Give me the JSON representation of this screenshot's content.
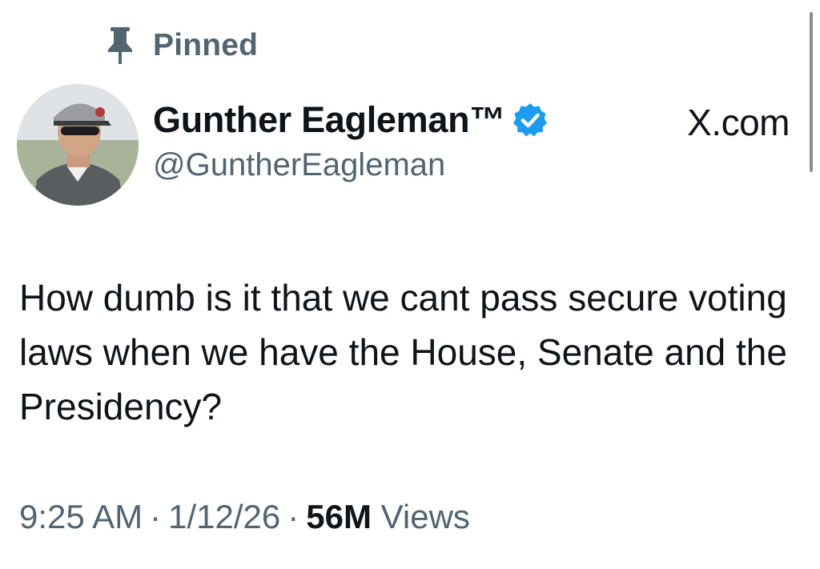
{
  "header": {
    "pinned_label": "Pinned"
  },
  "author": {
    "display_name": "Gunther Eagleman™",
    "handle": "@GuntherEagleman",
    "verified": true
  },
  "site_label": "X.com",
  "tweet": {
    "text": "How dumb is it that we cant pass secure voting laws when we have the House, Senate and the Presidency?"
  },
  "meta": {
    "time": "9:25 AM",
    "date": "1/12/26",
    "separator": "·",
    "views_count": "56M",
    "views_label": "Views"
  },
  "icons": {
    "pin": "pin-icon",
    "verified": "verified-badge-icon",
    "avatar": "profile-photo"
  },
  "colors": {
    "text_primary": "#0f1419",
    "text_secondary": "#536471",
    "verified_blue": "#1d9bf0",
    "background": "#ffffff"
  }
}
